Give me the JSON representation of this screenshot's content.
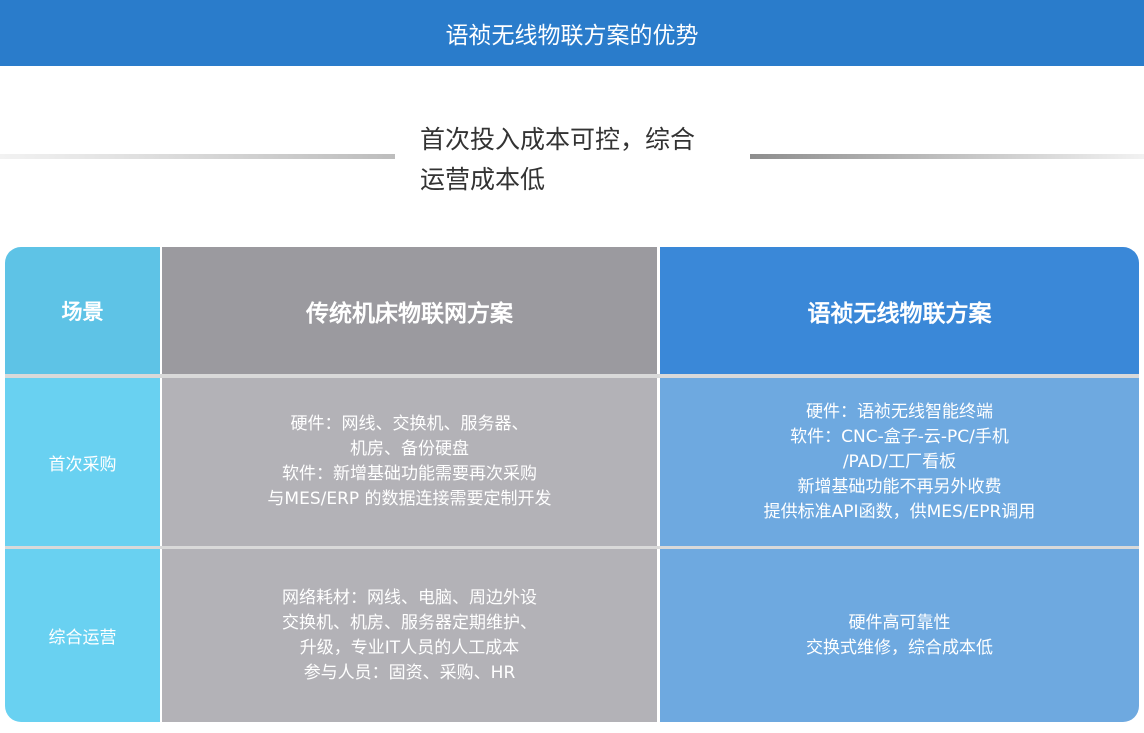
{
  "banner": {
    "title": "语祯无线物联方案的优势"
  },
  "headline": {
    "line1": "首次投入成本可控，综合",
    "line2": "运营成本低"
  },
  "table": {
    "headers": {
      "scene": "场景",
      "traditional": "传统机床物联网方案",
      "yuzhen": "语祯无线物联方案"
    },
    "rows": [
      {
        "scene": "首次采购",
        "traditional": [
          "硬件：网线、交换机、服务器、",
          "机房、备份硬盘",
          "软件：新增基础功能需要再次采购",
          "与MES/ERP 的数据连接需要定制开发"
        ],
        "yuzhen": [
          "硬件：语祯无线智能终端",
          "软件：CNC-盒子-云-PC/手机",
          "/PAD/工厂看板",
          "新增基础功能不再另外收费",
          "提供标准API函数，供MES/EPR调用"
        ]
      },
      {
        "scene": "综合运营",
        "traditional": [
          "网络耗材：网线、电脑、周边外设",
          "交换机、机房、服务器定期维护、",
          "升级，专业IT人员的人工成本",
          "参与人员：固资、采购、HR"
        ],
        "yuzhen": [
          "硬件高可靠性",
          "交换式维修，综合成本低"
        ]
      }
    ]
  }
}
